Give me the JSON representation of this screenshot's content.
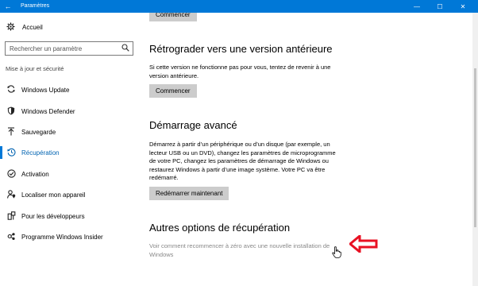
{
  "window": {
    "title": "Paramètres",
    "back_glyph": "←",
    "min_glyph": "—",
    "max_glyph": "☐",
    "close_glyph": "✕"
  },
  "sidebar": {
    "home_label": "Accueil",
    "search_placeholder": "Rechercher un paramètre",
    "section_label": "Mise à jour et sécurité",
    "items": [
      {
        "label": "Windows Update",
        "icon": "sync-icon"
      },
      {
        "label": "Windows Defender",
        "icon": "shield-icon"
      },
      {
        "label": "Sauvegarde",
        "icon": "backup-arrow-icon"
      },
      {
        "label": "Récupération",
        "icon": "history-icon",
        "active": true
      },
      {
        "label": "Activation",
        "icon": "check-circle-icon"
      },
      {
        "label": "Localiser mon appareil",
        "icon": "person-location-icon"
      },
      {
        "label": "Pour les développeurs",
        "icon": "developer-tools-icon"
      },
      {
        "label": "Programme Windows Insider",
        "icon": "insider-icon"
      }
    ]
  },
  "main": {
    "top_button": "Commencer",
    "rollback": {
      "title": "Rétrograder vers une version antérieure",
      "desc": "Si cette version ne fonctionne pas pour vous, tentez de revenir à une version antérieure.",
      "button": "Commencer"
    },
    "advanced": {
      "title": "Démarrage avancé",
      "desc": "Démarrez à partir d’un périphérique ou d’un disque (par exemple, un lecteur USB ou un DVD), changez les paramètres de microprogramme de votre PC, changez les paramètres de démarrage de Windows ou restaurez Windows à partir d’une image système. Votre PC va être redémarré.",
      "button": "Redémarrer maintenant"
    },
    "other": {
      "title": "Autres options de récupération",
      "link": "Voir comment recommencer à zéro avec une nouvelle installation de Windows"
    }
  },
  "colors": {
    "accent": "#0078d7",
    "arrow": "#e81123",
    "button_bg": "#cccccc"
  }
}
